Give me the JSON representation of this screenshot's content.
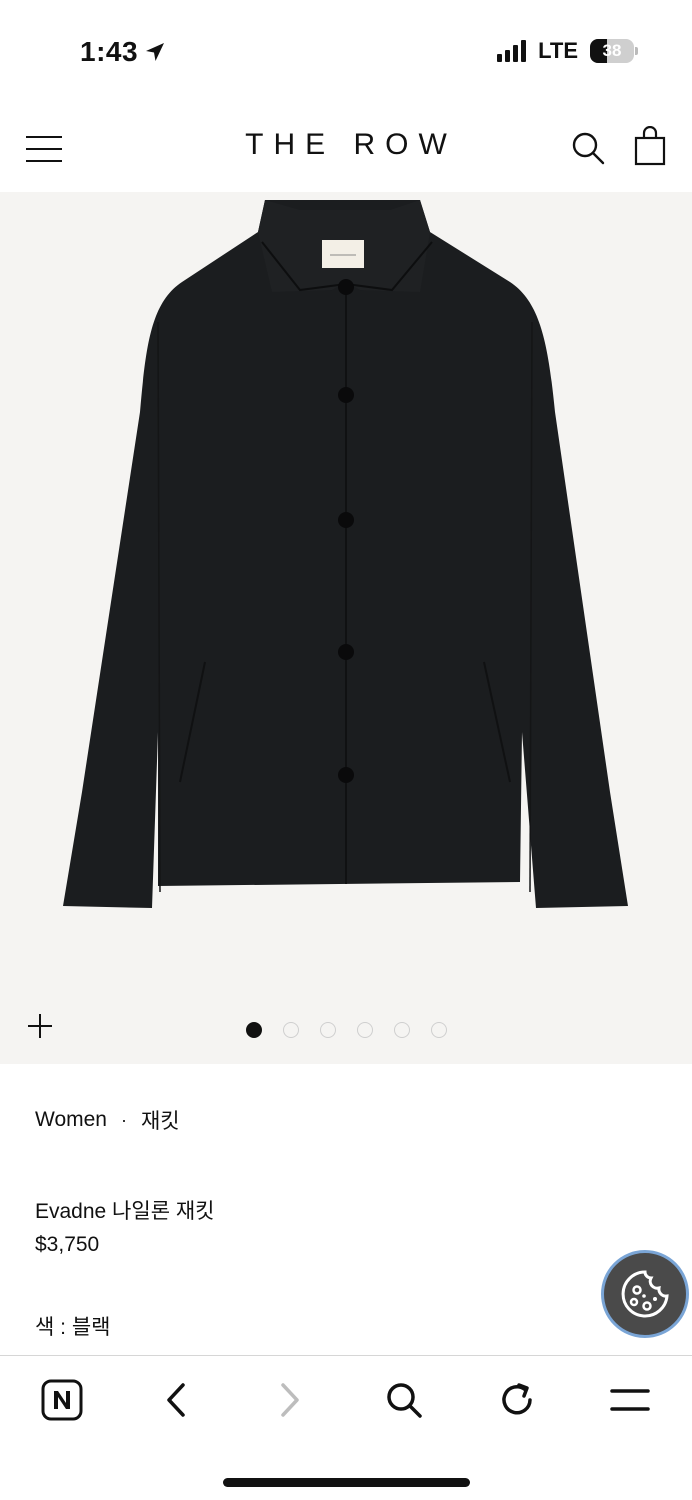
{
  "status": {
    "time": "1:43",
    "network": "LTE",
    "battery": "38"
  },
  "header": {
    "brand": "THE ROW"
  },
  "gallery": {
    "slide_count": 6,
    "active_index": 0,
    "image_subject": "black nylon jacket"
  },
  "product": {
    "breadcrumb": [
      "Women",
      "·",
      "재킷"
    ],
    "name": "Evadne 나일론 재킷",
    "price": "$3,750",
    "color_label": "색 : 블랙"
  },
  "icons": {
    "menu": "hamburger-icon",
    "search": "search-icon",
    "bag": "shopping-bag-icon",
    "zoom": "plus-icon",
    "cookie": "cookie-icon",
    "browser_home": "naver-n-icon",
    "back": "chevron-left-icon",
    "forward": "chevron-right-icon",
    "browser_search": "search-icon",
    "reload": "reload-icon",
    "browser_menu": "menu-icon"
  },
  "colors": {
    "image_background": "#f5f4f2",
    "jacket": "#1b1d1f",
    "cookie_button": "#4a4a4a",
    "cookie_ring": "#7aa5d6"
  }
}
